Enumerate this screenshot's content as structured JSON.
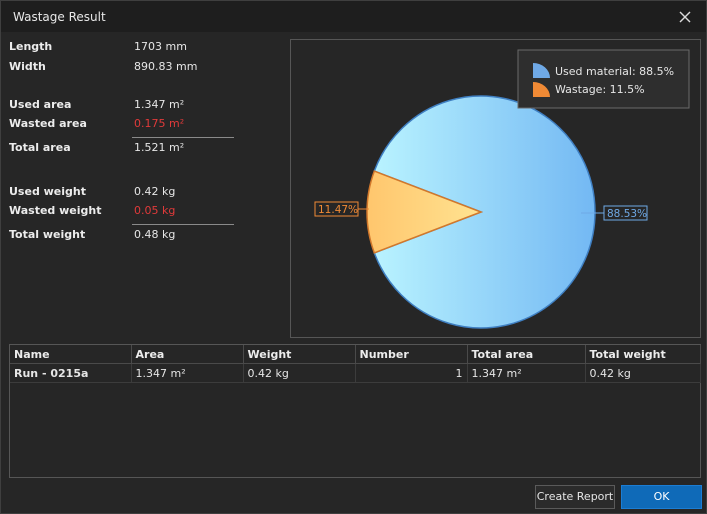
{
  "window": {
    "title": "Wastage Result"
  },
  "summary": [
    {
      "label": "Length",
      "value": "1703 mm",
      "highlight": false
    },
    {
      "label": "Width",
      "value": "890.83 mm",
      "highlight": false
    },
    {
      "label": "Used area",
      "value": "1.347 m²",
      "highlight": false
    },
    {
      "label": "Wasted area",
      "value": "0.175 m²",
      "highlight": true
    },
    {
      "label": "Total area",
      "value": "1.521 m²",
      "highlight": false
    },
    {
      "label": "Used weight",
      "value": "0.42 kg",
      "highlight": false
    },
    {
      "label": "Wasted weight",
      "value": "0.05 kg",
      "highlight": true
    },
    {
      "label": "Total weight",
      "value": "0.48 kg",
      "highlight": false
    }
  ],
  "chart_data": {
    "type": "pie",
    "slices": [
      {
        "name": "Used material",
        "legend": "Used material: 88.5%",
        "value": 88.53,
        "label": "88.53%",
        "color": "#7ec3f5"
      },
      {
        "name": "Wastage",
        "legend": "Wastage: 11.5%",
        "value": 11.47,
        "label": "11.47%",
        "color": "#f3a14a"
      }
    ],
    "legend_position": "top-right"
  },
  "grid": {
    "columns": [
      "Name",
      "Area",
      "Weight",
      "Number",
      "Total area",
      "Total weight"
    ],
    "rows": [
      [
        "Run - 0215a",
        "1.347 m²",
        "0.42 kg",
        "1",
        "1.347 m²",
        "0.42 kg"
      ]
    ]
  },
  "buttons": {
    "report": "Create Report",
    "ok": "OK"
  },
  "colors": {
    "wasted_text": "#e03a3a",
    "ok_button": "#0f6ab8",
    "used": "#7ec3f5",
    "wastage": "#f3a14a"
  }
}
